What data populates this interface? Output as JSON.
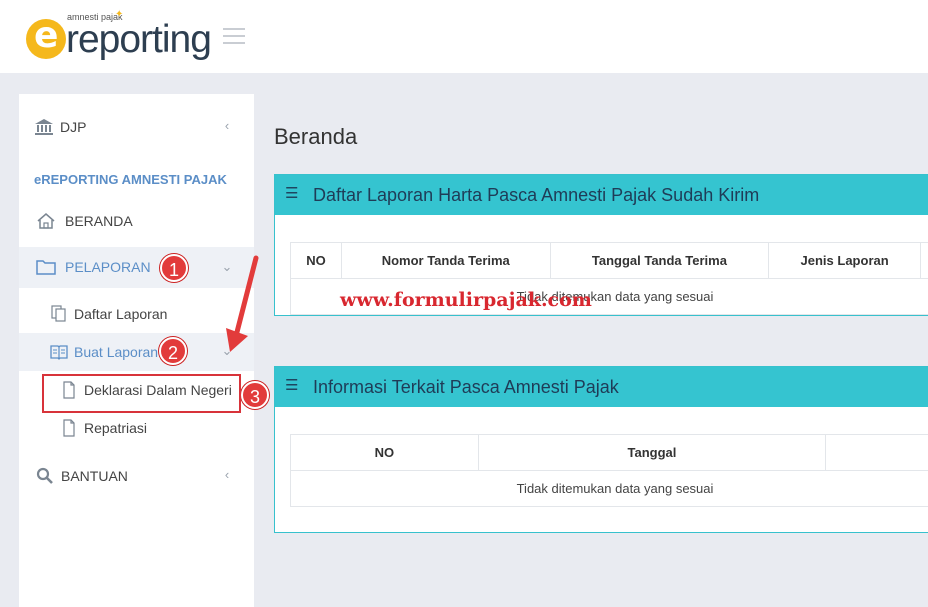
{
  "header": {
    "logo_sub": "amnesti pajak",
    "logo_e": "e",
    "logo_word": "reporting"
  },
  "sidebar": {
    "user": "DJP",
    "section": "eREPORTING AMNESTI PAJAK",
    "items": [
      {
        "label": "BERANDA"
      },
      {
        "label": "PELAPORAN"
      },
      {
        "label": "Daftar Laporan"
      },
      {
        "label": "Buat Laporan"
      },
      {
        "label": "Deklarasi Dalam Negeri"
      },
      {
        "label": "Repatriasi"
      },
      {
        "label": "BANTUAN"
      }
    ]
  },
  "annotations": {
    "badge1": "1",
    "badge2": "2",
    "badge3": "3",
    "watermark": "www.formulirpajak.com"
  },
  "main": {
    "title": "Beranda",
    "panels": [
      {
        "title": "Daftar Laporan Harta Pasca Amnesti Pajak Sudah Kirim",
        "columns": [
          "NO",
          "Nomor Tanda Terima",
          "Tanggal Tanda Terima",
          "Jenis Laporan",
          ""
        ],
        "empty_text": "Tidak ditemukan data yang sesuai"
      },
      {
        "title": "Informasi Terkait Pasca Amnesti Pajak",
        "columns": [
          "NO",
          "Tanggal",
          ""
        ],
        "empty_text": "Tidak ditemukan data yang sesuai"
      }
    ]
  },
  "colors": {
    "panel_header": "#35c4d0",
    "accent_blue": "#5b8ec7",
    "annotation_red": "#e23b3b",
    "logo_yellow": "#f5b81c"
  }
}
